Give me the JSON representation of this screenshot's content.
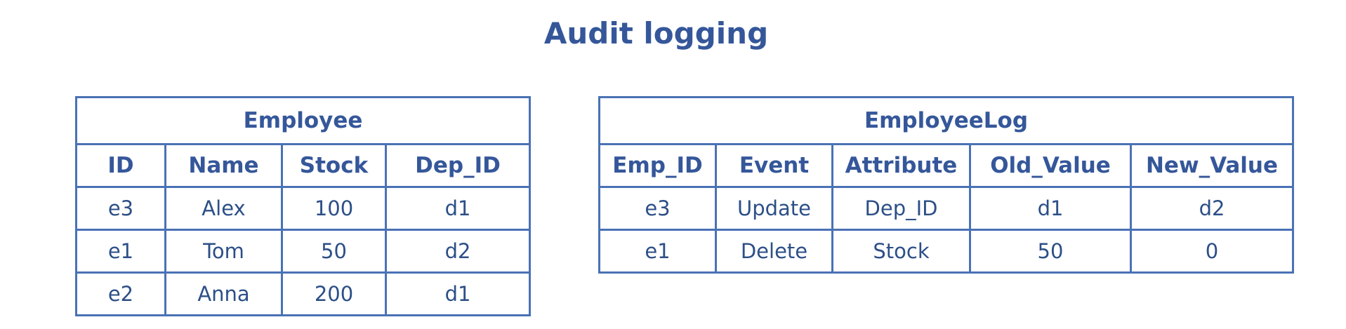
{
  "title": "Audit logging",
  "employee": {
    "caption": "Employee",
    "columns": [
      "ID",
      "Name",
      "Stock",
      "Dep_ID"
    ],
    "rows": [
      [
        "e3",
        "Alex",
        "100",
        "d1"
      ],
      [
        "e1",
        "Tom",
        "50",
        "d2"
      ],
      [
        "e2",
        "Anna",
        "200",
        "d1"
      ]
    ]
  },
  "employee_log": {
    "caption": "EmployeeLog",
    "columns": [
      "Emp_ID",
      "Event",
      "Attribute",
      "Old_Value",
      "New_Value"
    ],
    "rows": [
      [
        "e3",
        "Update",
        "Dep_ID",
        "d1",
        "d2"
      ],
      [
        "e1",
        "Delete",
        "Stock",
        "50",
        "0"
      ]
    ]
  },
  "colors": {
    "border": "#4a72b5",
    "heading_text": "#35579a",
    "cell_text": "#2c4f87",
    "background": "#ffffff"
  }
}
